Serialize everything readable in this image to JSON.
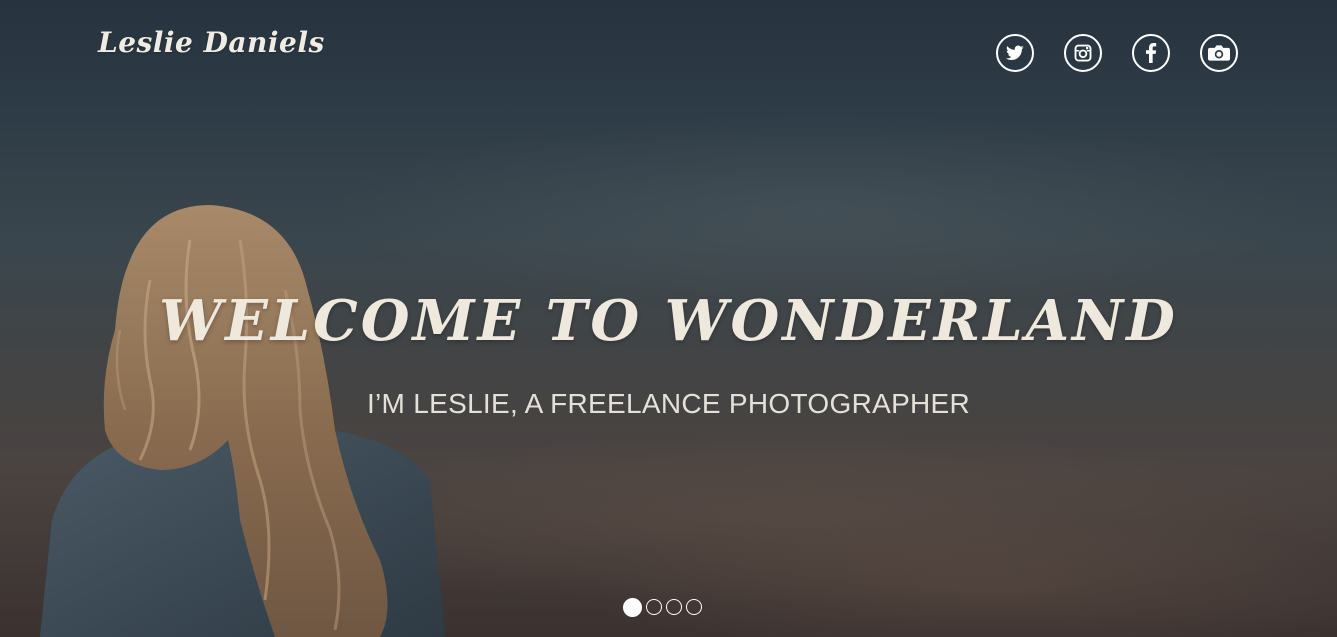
{
  "brand": {
    "name": "Leslie Daniels"
  },
  "socials": [
    {
      "icon": "twitter-icon"
    },
    {
      "icon": "instagram-icon"
    },
    {
      "icon": "facebook-icon"
    },
    {
      "icon": "camera-icon"
    }
  ],
  "hero": {
    "headline": "WELCOME TO WONDERLAND",
    "subtitle": "I’M LESLIE, A FREELANCE PHOTOGRAPHER"
  },
  "slider": {
    "slides": 4,
    "active": 1
  },
  "colors": {
    "text": "#efe9dd",
    "icon_outline": "#ffffff",
    "sky_top": "#27333f",
    "ground": "#4a4340"
  }
}
